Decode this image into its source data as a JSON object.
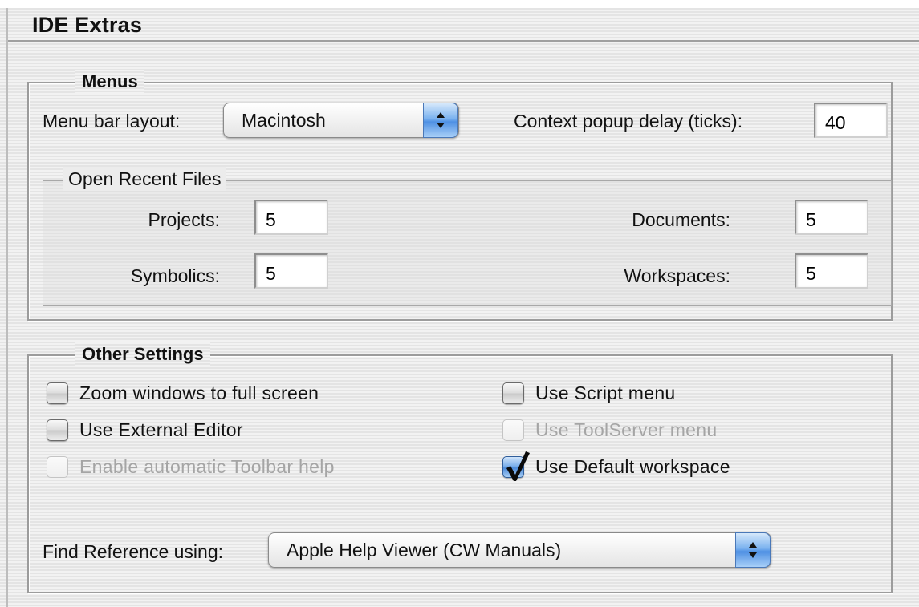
{
  "window": {
    "title": "IDE Extras"
  },
  "menus": {
    "title": "Menus",
    "menu_bar_layout_label": "Menu bar layout:",
    "menu_bar_layout_value": "Macintosh",
    "context_popup_delay_label": "Context popup delay (ticks):",
    "context_popup_delay_value": "40",
    "open_recent": {
      "title": "Open Recent Files",
      "projects_label": "Projects:",
      "projects_value": "5",
      "documents_label": "Documents:",
      "documents_value": "5",
      "symbolics_label": "Symbolics:",
      "symbolics_value": "5",
      "workspaces_label": "Workspaces:",
      "workspaces_value": "5"
    }
  },
  "other": {
    "title": "Other Settings",
    "checkboxes": {
      "zoom": {
        "label": "Zoom windows to full screen",
        "checked": false,
        "enabled": true
      },
      "external_editor": {
        "label": "Use External Editor",
        "checked": false,
        "enabled": true
      },
      "toolbar_help": {
        "label": "Enable automatic Toolbar help",
        "checked": false,
        "enabled": false
      },
      "script_menu": {
        "label": "Use Script menu",
        "checked": false,
        "enabled": true
      },
      "toolserver_menu": {
        "label": "Use ToolServer menu",
        "checked": false,
        "enabled": false
      },
      "default_workspace": {
        "label": "Use Default workspace",
        "checked": true,
        "enabled": true
      }
    },
    "find_reference_label": "Find Reference using:",
    "find_reference_value": "Apple Help Viewer (CW Manuals)"
  },
  "colors": {
    "aqua_blue": "#4e90e3",
    "disabled_text": "#a5a5a5",
    "group_border": "#9c9c9c"
  },
  "icons": {
    "popup_arrows": "updown-arrows-icon",
    "checkmark": "checkmark-icon"
  }
}
